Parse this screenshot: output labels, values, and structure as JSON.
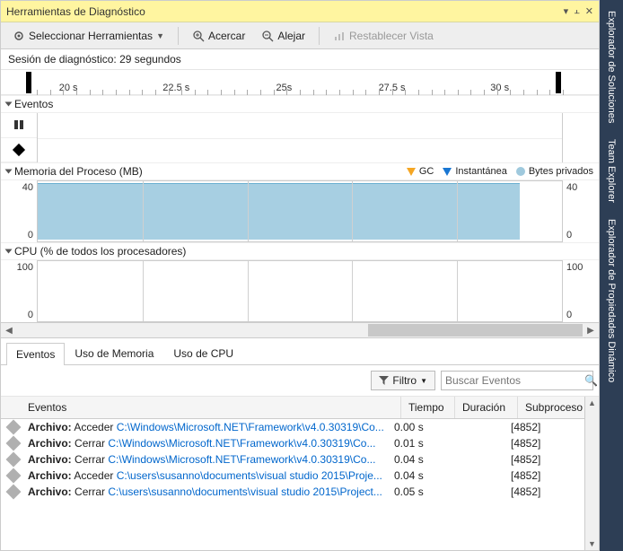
{
  "title": "Herramientas de Diagnóstico",
  "toolbar": {
    "select_tools": "Seleccionar Herramientas",
    "zoom_in": "Acercar",
    "zoom_out": "Alejar",
    "reset_view": "Restablecer Vista"
  },
  "session_label": "Sesión de diagnóstico: 29 segundos",
  "ruler_ticks": [
    "20 s",
    "22.5 s",
    "25s",
    "27.5 s",
    "30 s"
  ],
  "lanes": {
    "events": "Eventos",
    "memory": "Memoria del Proceso (MB)",
    "cpu": "CPU (% de todos los procesadores)"
  },
  "legend": {
    "gc": "GC",
    "snapshot": "Instantánea",
    "bytes": "Bytes privados"
  },
  "mem_axis": {
    "max": "40",
    "min": "0"
  },
  "cpu_axis": {
    "max": "100",
    "min": "0"
  },
  "tabs": {
    "events": "Eventos",
    "memory": "Uso de Memoria",
    "cpu": "Uso de CPU"
  },
  "filter_label": "Filtro",
  "search_placeholder": "Buscar Eventos",
  "columns": {
    "events": "Eventos",
    "time": "Tiempo",
    "duration": "Duración",
    "thread": "Subproceso"
  },
  "rows": [
    {
      "prefix": "Archivo:",
      "action": "Acceder",
      "path": "C:\\Windows\\Microsoft.NET\\Framework\\v4.0.30319\\Co...",
      "time": "0.00 s",
      "duration": "",
      "thread": "[4852]"
    },
    {
      "prefix": "Archivo:",
      "action": "Cerrar",
      "path": "C:\\Windows\\Microsoft.NET\\Framework\\v4.0.30319\\Co...",
      "time": "0.01 s",
      "duration": "",
      "thread": "[4852]"
    },
    {
      "prefix": "Archivo:",
      "action": "Cerrar",
      "path": "C:\\Windows\\Microsoft.NET\\Framework\\v4.0.30319\\Co...",
      "time": "0.04 s",
      "duration": "",
      "thread": "[4852]"
    },
    {
      "prefix": "Archivo:",
      "action": "Acceder",
      "path": "C:\\users\\susanno\\documents\\visual studio 2015\\Proje...",
      "time": "0.04 s",
      "duration": "",
      "thread": "[4852]"
    },
    {
      "prefix": "Archivo:",
      "action": "Cerrar",
      "path": "C:\\users\\susanno\\documents\\visual studio 2015\\Project...",
      "time": "0.05 s",
      "duration": "",
      "thread": "[4852]"
    }
  ],
  "side_tabs": [
    "Explorador de Soluciones",
    "Team Explorer",
    "Explorador de Propiedades Dinámico"
  ],
  "chart_data": [
    {
      "type": "area",
      "title": "Memoria del Proceso (MB)",
      "ylabel": "MB",
      "ylim": [
        0,
        40
      ],
      "x_range_seconds": [
        18.5,
        31.5
      ],
      "series": [
        {
          "name": "Bytes privados",
          "approx_constant_value": 38,
          "visible_x_range": [
            18.5,
            30.2
          ]
        }
      ]
    },
    {
      "type": "line",
      "title": "CPU (% de todos los procesadores)",
      "ylabel": "%",
      "ylim": [
        0,
        100
      ],
      "x_range_seconds": [
        18.5,
        31.5
      ],
      "series": [
        {
          "name": "CPU",
          "approx_constant_value": 0
        }
      ]
    }
  ]
}
